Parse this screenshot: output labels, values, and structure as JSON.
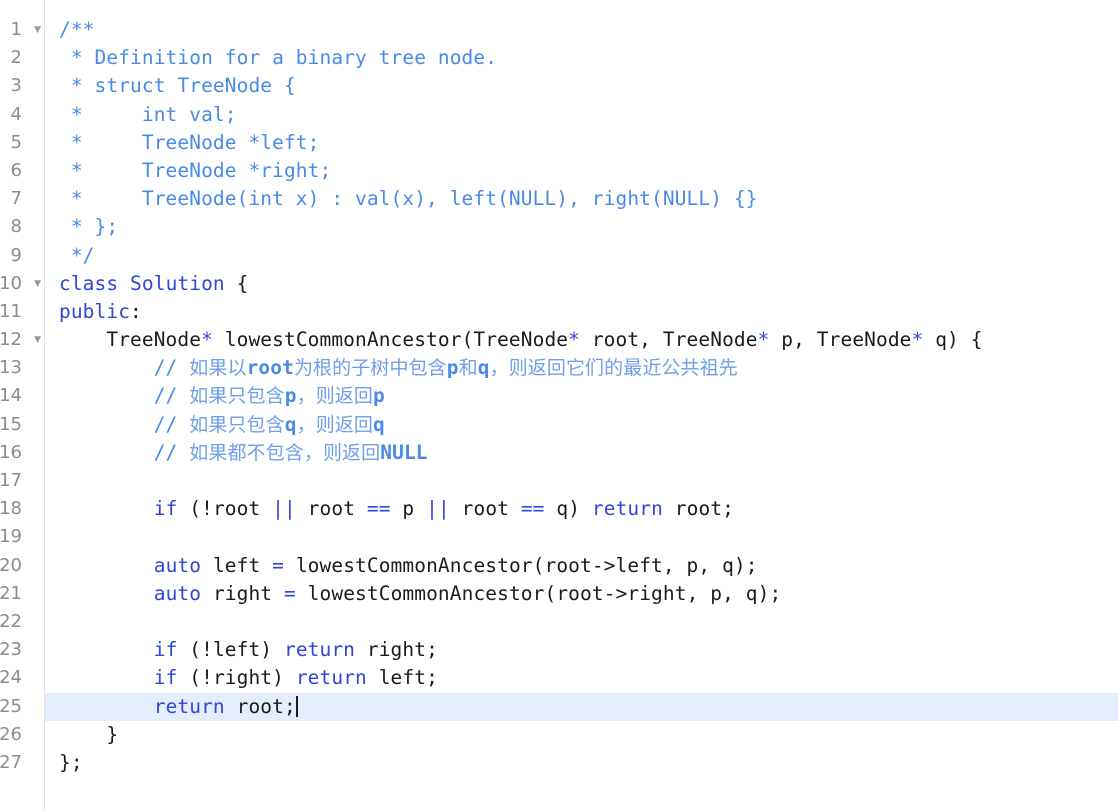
{
  "editor": {
    "language": "cpp",
    "background_color": "#ffffff",
    "active_line_color": "#e4edfb",
    "gutter_color": "#8c8c8c",
    "comment_color": "#4a8ae6",
    "keyword_color": "#2f46d8",
    "identifier_color": "#1b1b1b",
    "cjk_comment_color": "#6f9fe8",
    "active_line_number": "25",
    "fold_icon": "chevron-down-icon"
  },
  "gutter": {
    "line_numbers": [
      "1",
      "2",
      "3",
      "4",
      "5",
      "6",
      "7",
      "8",
      "9",
      "10",
      "11",
      "12",
      "13",
      "14",
      "15",
      "16",
      "17",
      "18",
      "19",
      "20",
      "21",
      "22",
      "23",
      "24",
      "25",
      "26",
      "27"
    ],
    "fold_lines": [
      "1",
      "10",
      "12"
    ]
  },
  "code": {
    "lines": [
      {
        "n": "1",
        "text": "/**"
      },
      {
        "n": "2",
        "text": " * Definition for a binary tree node."
      },
      {
        "n": "3",
        "text": " * struct TreeNode {"
      },
      {
        "n": "4",
        "text": " *     int val;"
      },
      {
        "n": "5",
        "text": " *     TreeNode *left;"
      },
      {
        "n": "6",
        "text": " *     TreeNode *right;"
      },
      {
        "n": "7",
        "text": " *     TreeNode(int x) : val(x), left(NULL), right(NULL) {}"
      },
      {
        "n": "8",
        "text": " * };"
      },
      {
        "n": "9",
        "text": " */"
      },
      {
        "n": "10",
        "text": "class Solution {"
      },
      {
        "n": "11",
        "text": "public:"
      },
      {
        "n": "12",
        "text": "    TreeNode* lowestCommonAncestor(TreeNode* root, TreeNode* p, TreeNode* q) {"
      },
      {
        "n": "13",
        "text": "        // 如果以root为根的子树中包含p和q，则返回它们的最近公共祖先"
      },
      {
        "n": "14",
        "text": "        // 如果只包含p，则返回p"
      },
      {
        "n": "15",
        "text": "        // 如果只包含q，则返回q"
      },
      {
        "n": "16",
        "text": "        // 如果都不包含，则返回NULL"
      },
      {
        "n": "17",
        "text": ""
      },
      {
        "n": "18",
        "text": "        if (!root || root == p || root == q) return root;"
      },
      {
        "n": "19",
        "text": ""
      },
      {
        "n": "20",
        "text": "        auto left = lowestCommonAncestor(root->left, p, q);"
      },
      {
        "n": "21",
        "text": "        auto right = lowestCommonAncestor(root->right, p, q);"
      },
      {
        "n": "22",
        "text": ""
      },
      {
        "n": "23",
        "text": "        if (!left) return right;"
      },
      {
        "n": "24",
        "text": "        if (!right) return left;"
      },
      {
        "n": "25",
        "text": "        return root;"
      },
      {
        "n": "26",
        "text": "    }"
      },
      {
        "n": "27",
        "text": "};"
      }
    ]
  },
  "tokens": {
    "l1": [
      {
        "t": "/**",
        "c": "cm"
      }
    ],
    "l2": [
      {
        "t": " * Definition for a binary tree node.",
        "c": "cm"
      }
    ],
    "l3": [
      {
        "t": " * struct TreeNode {",
        "c": "cm"
      }
    ],
    "l4": [
      {
        "t": " *     int val;",
        "c": "cm"
      }
    ],
    "l5": [
      {
        "t": " *     TreeNode *left;",
        "c": "cm"
      }
    ],
    "l6": [
      {
        "t": " *     TreeNode *right;",
        "c": "cm"
      }
    ],
    "l7": [
      {
        "t": " *     TreeNode(int x) : val(x), left(NULL), right(NULL) {}",
        "c": "cm"
      }
    ],
    "l8": [
      {
        "t": " * };",
        "c": "cm"
      }
    ],
    "l9": [
      {
        "t": " */",
        "c": "cm"
      }
    ],
    "l10": [
      {
        "t": "class",
        "c": "kw"
      },
      {
        "t": " ",
        "c": "id"
      },
      {
        "t": "Solution",
        "c": "kw"
      },
      {
        "t": " {",
        "c": "id"
      }
    ],
    "l11": [
      {
        "t": "public",
        "c": "kw"
      },
      {
        "t": ":",
        "c": "id"
      }
    ],
    "l12": [
      {
        "t": "    TreeNode",
        "c": "id"
      },
      {
        "t": "*",
        "c": "ast"
      },
      {
        "t": " lowestCommonAncestor(TreeNode",
        "c": "id"
      },
      {
        "t": "*",
        "c": "ast"
      },
      {
        "t": " root, TreeNode",
        "c": "id"
      },
      {
        "t": "*",
        "c": "ast"
      },
      {
        "t": " p, TreeNode",
        "c": "id"
      },
      {
        "t": "*",
        "c": "ast"
      },
      {
        "t": " q) {",
        "c": "id"
      }
    ],
    "l13": [
      {
        "t": "        // ",
        "c": "cm"
      },
      {
        "t": "如果以",
        "c": "cjk"
      },
      {
        "t": "root",
        "c": "cmh"
      },
      {
        "t": "为根的子树中包含",
        "c": "cjk"
      },
      {
        "t": "p",
        "c": "cmh"
      },
      {
        "t": "和",
        "c": "cjk"
      },
      {
        "t": "q",
        "c": "cmh"
      },
      {
        "t": "，则返回它们的最近公共祖先",
        "c": "cjk"
      }
    ],
    "l14": [
      {
        "t": "        // ",
        "c": "cm"
      },
      {
        "t": "如果只包含",
        "c": "cjk"
      },
      {
        "t": "p",
        "c": "cmh"
      },
      {
        "t": "，则返回",
        "c": "cjk"
      },
      {
        "t": "p",
        "c": "cmh"
      }
    ],
    "l15": [
      {
        "t": "        // ",
        "c": "cm"
      },
      {
        "t": "如果只包含",
        "c": "cjk"
      },
      {
        "t": "q",
        "c": "cmh"
      },
      {
        "t": "，则返回",
        "c": "cjk"
      },
      {
        "t": "q",
        "c": "cmh"
      }
    ],
    "l16": [
      {
        "t": "        // ",
        "c": "cm"
      },
      {
        "t": "如果都不包含，则返回",
        "c": "cjk"
      },
      {
        "t": "NULL",
        "c": "cmh"
      }
    ],
    "l17": [],
    "l18": [
      {
        "t": "        ",
        "c": "id"
      },
      {
        "t": "if",
        "c": "kw"
      },
      {
        "t": " (!root ",
        "c": "id"
      },
      {
        "t": "||",
        "c": "op"
      },
      {
        "t": " root ",
        "c": "id"
      },
      {
        "t": "==",
        "c": "op"
      },
      {
        "t": " p ",
        "c": "id"
      },
      {
        "t": "||",
        "c": "op"
      },
      {
        "t": " root ",
        "c": "id"
      },
      {
        "t": "==",
        "c": "op"
      },
      {
        "t": " q) ",
        "c": "id"
      },
      {
        "t": "return",
        "c": "kw"
      },
      {
        "t": " root;",
        "c": "id"
      }
    ],
    "l19": [],
    "l20": [
      {
        "t": "        ",
        "c": "id"
      },
      {
        "t": "auto",
        "c": "kw"
      },
      {
        "t": " left ",
        "c": "id"
      },
      {
        "t": "=",
        "c": "op"
      },
      {
        "t": " lowestCommonAncestor(root->left, p, q);",
        "c": "id"
      }
    ],
    "l21": [
      {
        "t": "        ",
        "c": "id"
      },
      {
        "t": "auto",
        "c": "kw"
      },
      {
        "t": " right ",
        "c": "id"
      },
      {
        "t": "=",
        "c": "op"
      },
      {
        "t": " lowestCommonAncestor(root->right, p, q);",
        "c": "id"
      }
    ],
    "l22": [],
    "l23": [
      {
        "t": "        ",
        "c": "id"
      },
      {
        "t": "if",
        "c": "kw"
      },
      {
        "t": " (!left) ",
        "c": "id"
      },
      {
        "t": "return",
        "c": "kw"
      },
      {
        "t": " right;",
        "c": "id"
      }
    ],
    "l24": [
      {
        "t": "        ",
        "c": "id"
      },
      {
        "t": "if",
        "c": "kw"
      },
      {
        "t": " (!right) ",
        "c": "id"
      },
      {
        "t": "return",
        "c": "kw"
      },
      {
        "t": " left;",
        "c": "id"
      }
    ],
    "l25": [
      {
        "t": "        ",
        "c": "id"
      },
      {
        "t": "return",
        "c": "kw"
      },
      {
        "t": " root;",
        "c": "id"
      }
    ],
    "l26": [
      {
        "t": "    }",
        "c": "id"
      }
    ],
    "l27": [
      {
        "t": "};",
        "c": "id"
      }
    ]
  }
}
